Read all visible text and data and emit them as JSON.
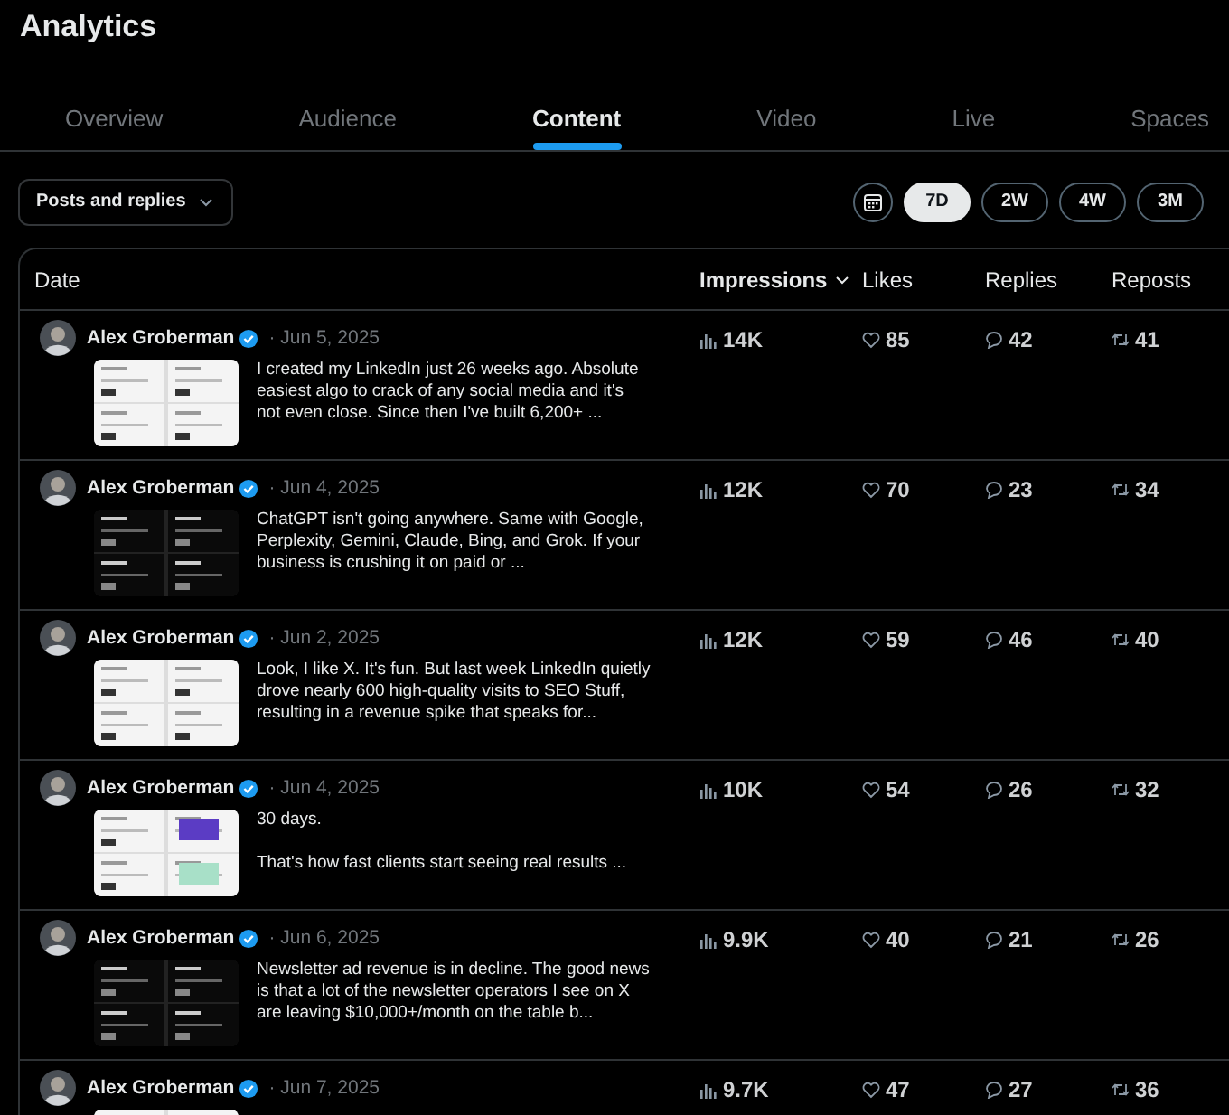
{
  "header": {
    "title": "Analytics"
  },
  "tabs": [
    {
      "label": "Overview",
      "selected": false
    },
    {
      "label": "Audience",
      "selected": false
    },
    {
      "label": "Content",
      "selected": true
    },
    {
      "label": "Video",
      "selected": false
    },
    {
      "label": "Live",
      "selected": false
    },
    {
      "label": "Spaces",
      "selected": false
    }
  ],
  "filter": {
    "label": "Posts and replies"
  },
  "periods": [
    {
      "label": "7D",
      "selected": true
    },
    {
      "label": "2W",
      "selected": false
    },
    {
      "label": "4W",
      "selected": false
    },
    {
      "label": "3M",
      "selected": false
    }
  ],
  "table": {
    "columns": [
      {
        "label": "Date",
        "sorted": false
      },
      {
        "label": "Impressions",
        "sorted": true
      },
      {
        "label": "Likes",
        "sorted": false
      },
      {
        "label": "Replies",
        "sorted": false
      },
      {
        "label": "Reposts",
        "sorted": false
      }
    ],
    "rows": [
      {
        "author": "Alex Groberman",
        "verified": true,
        "date": "· Jun 5, 2025",
        "text": "I created my LinkedIn just 26 weeks ago. Absolute easiest algo to crack of any social media and it's not even close. Since then I've built 6,200+ ...",
        "impressions": "14K",
        "likes": "85",
        "replies": "42",
        "reposts": "41"
      },
      {
        "author": "Alex Groberman",
        "verified": true,
        "date": "· Jun 4, 2025",
        "text": "ChatGPT isn't going anywhere. Same with Google, Perplexity, Gemini, Claude, Bing, and Grok. If your business is crushing it on paid or ...",
        "impressions": "12K",
        "likes": "70",
        "replies": "23",
        "reposts": "34"
      },
      {
        "author": "Alex Groberman",
        "verified": true,
        "date": "· Jun 2, 2025",
        "text": "Look, I like X. It's fun. But last week LinkedIn quietly drove nearly 600 high-quality visits to SEO Stuff, resulting in a revenue spike that speaks for...",
        "impressions": "12K",
        "likes": "59",
        "replies": "46",
        "reposts": "40"
      },
      {
        "author": "Alex Groberman",
        "verified": true,
        "date": "· Jun 4, 2025",
        "text": "30 days.\n\nThat's how fast clients start seeing real results ...",
        "impressions": "10K",
        "likes": "54",
        "replies": "26",
        "reposts": "32"
      },
      {
        "author": "Alex Groberman",
        "verified": true,
        "date": "· Jun 6, 2025",
        "text": "Newsletter ad revenue is in decline. The good news is that a lot of the newsletter operators I see on X are leaving $10,000+/month on the table b...",
        "impressions": "9.9K",
        "likes": "40",
        "replies": "21",
        "reposts": "26"
      },
      {
        "author": "Alex Groberman",
        "verified": true,
        "date": "· Jun 7, 2025",
        "impressions": "9.7K",
        "likes": "47",
        "replies": "27",
        "reposts": "36"
      }
    ]
  }
}
